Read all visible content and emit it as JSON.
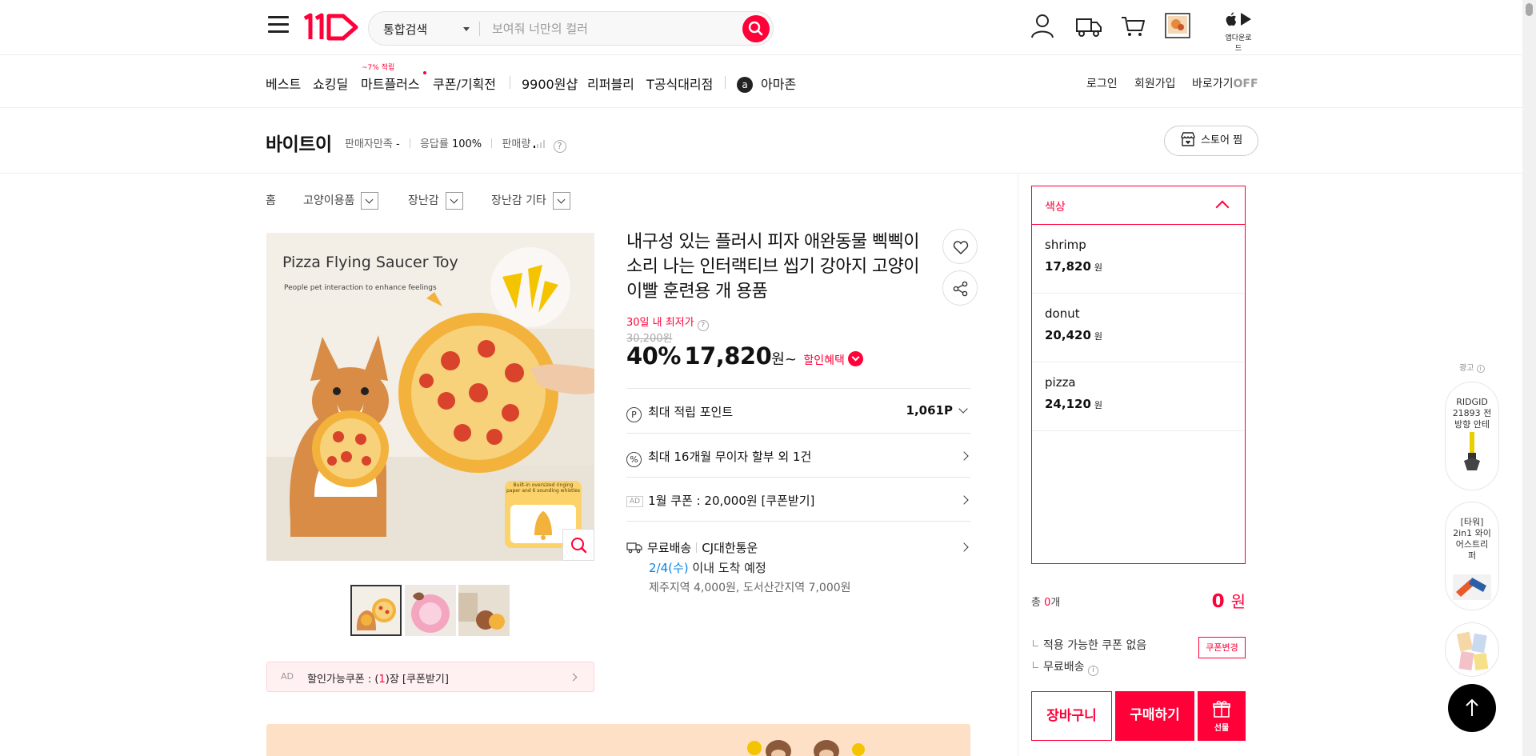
{
  "header": {
    "search_category": "통합검색",
    "search_placeholder": "보여줘 너만의 컬러",
    "app_download": "앱다운로드"
  },
  "nav": {
    "items": [
      "베스트",
      "쇼킹딜",
      "마트플러스",
      "쿠폰/기획전",
      "9900원샵",
      "리퍼블리",
      "T공식대리점",
      "아마존"
    ],
    "mart_badge": "~7% 적립",
    "right": {
      "login": "로그인",
      "signup": "회원가입",
      "shortcut": "바로가기",
      "shortcut_state": "OFF"
    }
  },
  "seller": {
    "name": "바이트이",
    "satisfaction_label": "판매자만족",
    "satisfaction_value": "-",
    "response_label": "응답률",
    "response_value": "100%",
    "sales_label": "판매량",
    "store_button": "스토어 찜"
  },
  "breadcrumb": [
    "홈",
    "고양이용품",
    "장난감",
    "장난감 기타"
  ],
  "product": {
    "image_title": "Pizza Flying Saucer Toy",
    "image_subtitle": "People pet interaction to enhance feelings",
    "image_badge": "Built-in oversized ringing paper and 6 sounding whistles",
    "title": "내구성 있는 플러시 피자 애완동물 삑삑이 소리 나는 인터랙티브 씹기 강아지 고양이 이빨 훈련용 개 용품",
    "lowest_label": "30일 내 최저가",
    "original_price": "30,200원",
    "discount": "40%",
    "price": "17,820",
    "price_unit": "원~",
    "benefit_label": "할인혜택",
    "points_label": "최대 적립 포인트",
    "points_value": "1,061P",
    "installment": "최대 16개월 무이자 할부 외 1건",
    "ad_tag": "AD",
    "coupon_row": "1월 쿠폰 : 20,000원 [쿠폰받기]",
    "delivery_label": "무료배송",
    "delivery_carrier": "CJ대한통운",
    "delivery_date": "2/4(수)",
    "delivery_eta": " 이내 도착 예정",
    "delivery_extra": "제주지역 4,000원, 도서산간지역 7,000원",
    "coupon_bar_ad": "AD",
    "coupon_bar_prefix": "할인가능쿠폰 : (",
    "coupon_bar_count": "1",
    "coupon_bar_suffix": ")장 [쿠폰받기]"
  },
  "options": {
    "header": "색상",
    "items": [
      {
        "name": "shrimp",
        "price": "17,820",
        "unit": "원"
      },
      {
        "name": "donut",
        "price": "20,420",
        "unit": "원"
      },
      {
        "name": "pizza",
        "price": "24,120",
        "unit": "원"
      }
    ],
    "total_prefix": "총 ",
    "total_count": "0",
    "total_suffix": "개",
    "total_value": "0",
    "total_unit": "원",
    "coupon_note": "적용 가능한 쿠폰 없음",
    "coupon_change": "쿠폰변경",
    "free_shipping": "무료배송",
    "cart_button": "장바구니",
    "buy_button": "구매하기",
    "gift_button": "선물"
  },
  "ad_rail": {
    "label": "광고",
    "card1": "RIDGID 21893 전방향 안테",
    "card2": "[타워] 2in1 와이어스트리퍼"
  },
  "colors": {
    "brand": "#ff0038",
    "link_blue": "#0b83e6"
  }
}
